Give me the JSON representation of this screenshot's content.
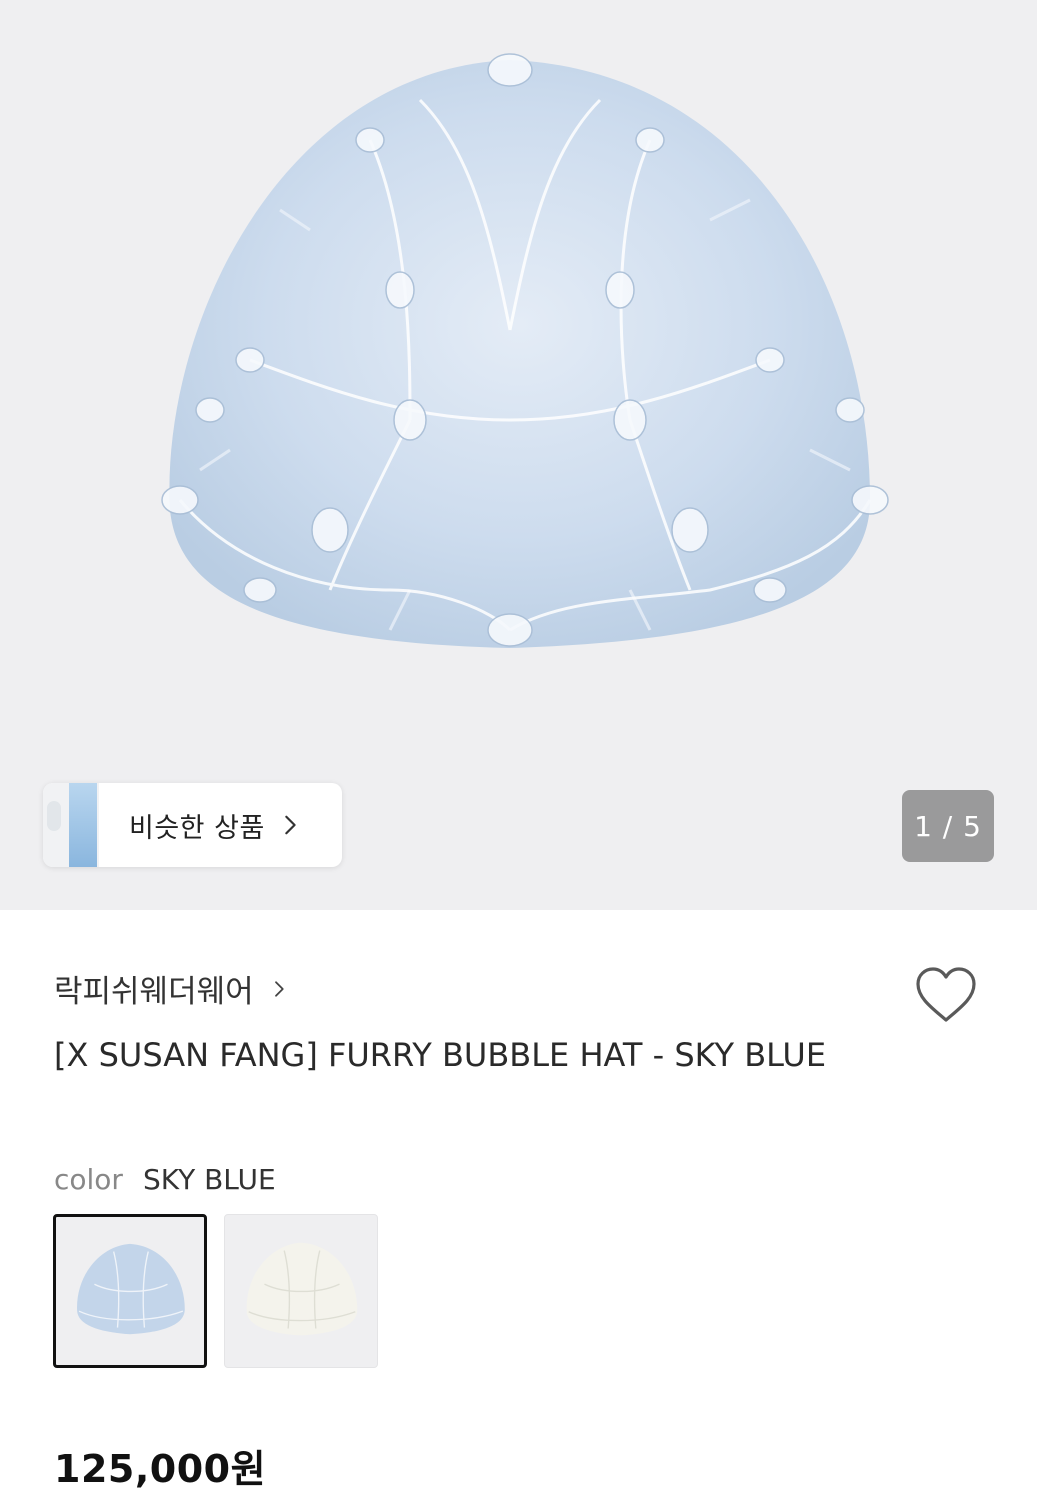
{
  "gallery": {
    "similar_button_label": "비슷한 상품",
    "image_counter": "1 / 5"
  },
  "product": {
    "brand": "락피쉬웨더웨어",
    "title": "[X SUSAN FANG] FURRY BUBBLE HAT - SKY BLUE",
    "color_label": "color",
    "color_value": "SKY BLUE",
    "swatches": [
      {
        "name": "SKY BLUE",
        "tone": "#c6d8ec",
        "selected": true
      },
      {
        "name": "WHITE",
        "tone": "#f3f2ec",
        "selected": false
      }
    ],
    "price": "125,000원"
  },
  "icons": {
    "similar": "chevron-right-icon",
    "brand": "chevron-right-icon",
    "wishlist": "heart-outline-icon"
  },
  "colors": {
    "hero_background": "#efeff1",
    "hat_fur": "#cdddef",
    "counter_background": "#7a7a7c"
  }
}
